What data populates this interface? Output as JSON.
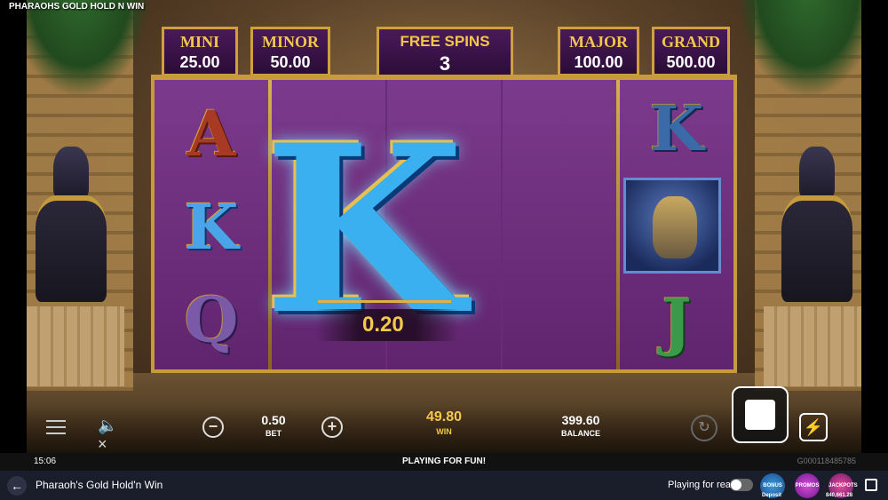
{
  "game_title": "PHARAOHS GOLD HOLD N WIN",
  "jackpots": [
    {
      "label": "MINI",
      "value": "25.00"
    },
    {
      "label": "MINOR",
      "value": "50.00"
    },
    {
      "label": "MAJOR",
      "value": "100.00"
    },
    {
      "label": "GRAND",
      "value": "500.00"
    }
  ],
  "free_spins": {
    "label": "FREE SPINS",
    "value": "3"
  },
  "reels": {
    "reel1": [
      "A",
      "K",
      "Q"
    ],
    "reel5": [
      "K",
      "J"
    ],
    "big_symbol": "K",
    "wild_icon": "pharaoh-wild-icon"
  },
  "line_win": "0.20",
  "hud": {
    "bet_value": "0.50",
    "bet_label": "BET",
    "minus": "−",
    "plus": "+",
    "win_value": "49.80",
    "win_label": "WIN",
    "balance_value": "399.60",
    "balance_label": "BALANCE"
  },
  "status": {
    "clock": "15:06",
    "mode": "PLAYING FOR FUN!",
    "round_id": "G000118485785"
  },
  "footer": {
    "title": "Pharaoh's Gold Hold'n Win",
    "play_real": "Playing for real",
    "badges": [
      {
        "label": "BONUS",
        "sub": "Deposit"
      },
      {
        "label": "PROMOS",
        "sub": ""
      },
      {
        "label": "JACKPOTS",
        "sub": "840,661.28"
      }
    ]
  },
  "colors": {
    "reel_purple": "#6a2a7a",
    "gold": "#f4c848",
    "frame_gold": "#c79a3c",
    "symbol_blue": "#3ab0f0"
  }
}
